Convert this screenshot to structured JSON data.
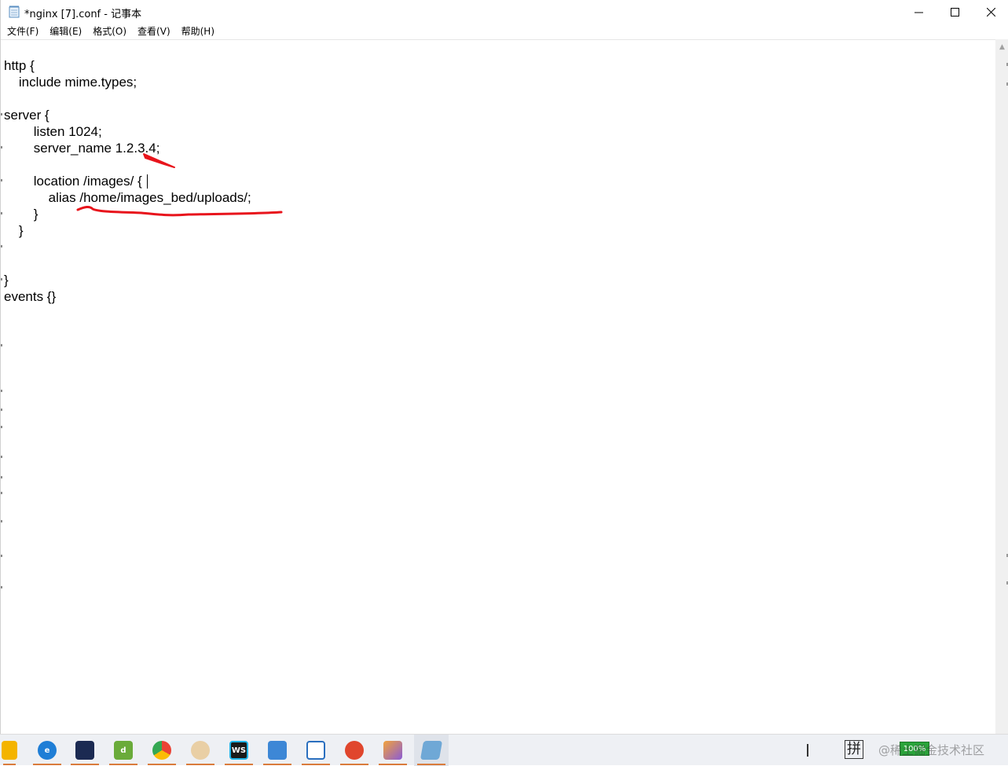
{
  "window": {
    "title": "*nginx [7].conf - 记事本"
  },
  "menu": {
    "items": [
      "文件(F)",
      "编辑(E)",
      "格式(O)",
      "查看(V)",
      "帮助(H)"
    ]
  },
  "editor": {
    "lines": [
      "http {",
      "    include mime.types;",
      "",
      "server {",
      "        listen 1024;",
      "        server_name 1.2.3.4;",
      "",
      "        location /images/ {",
      "            alias /home/images_bed/uploads/;",
      "        }",
      "    }",
      "",
      "",
      "}",
      "events {}"
    ]
  },
  "annotations": {
    "color": "#e8141c"
  },
  "taskbar": {
    "apps": [
      {
        "icon": "file-explorer-icon",
        "color": "#f4b400"
      },
      {
        "icon": "edge-icon",
        "color": "#1f7ed6"
      },
      {
        "icon": "cat-app-icon",
        "color": "#1b2a52"
      },
      {
        "icon": "download-manager-icon",
        "color": "#6aab3a"
      },
      {
        "icon": "chrome-icon",
        "color": "#34a853"
      },
      {
        "icon": "dog-avatar-icon",
        "color": "#e9cfa5"
      },
      {
        "icon": "webstorm-icon",
        "color": "#1a1a1a"
      },
      {
        "icon": "diagram-app-icon",
        "color": "#3d87d6"
      },
      {
        "icon": "window-app-icon",
        "color": "#2a6fbf"
      },
      {
        "icon": "snail-app-icon",
        "color": "#e0462d"
      },
      {
        "icon": "mountain-app-icon",
        "color": "#8a5bd6"
      },
      {
        "icon": "notepad-icon",
        "color": "#6fa8d6"
      }
    ],
    "ime_label": "拼",
    "battery_label": "100%",
    "watermark": "@稀土掘金技术社区"
  }
}
